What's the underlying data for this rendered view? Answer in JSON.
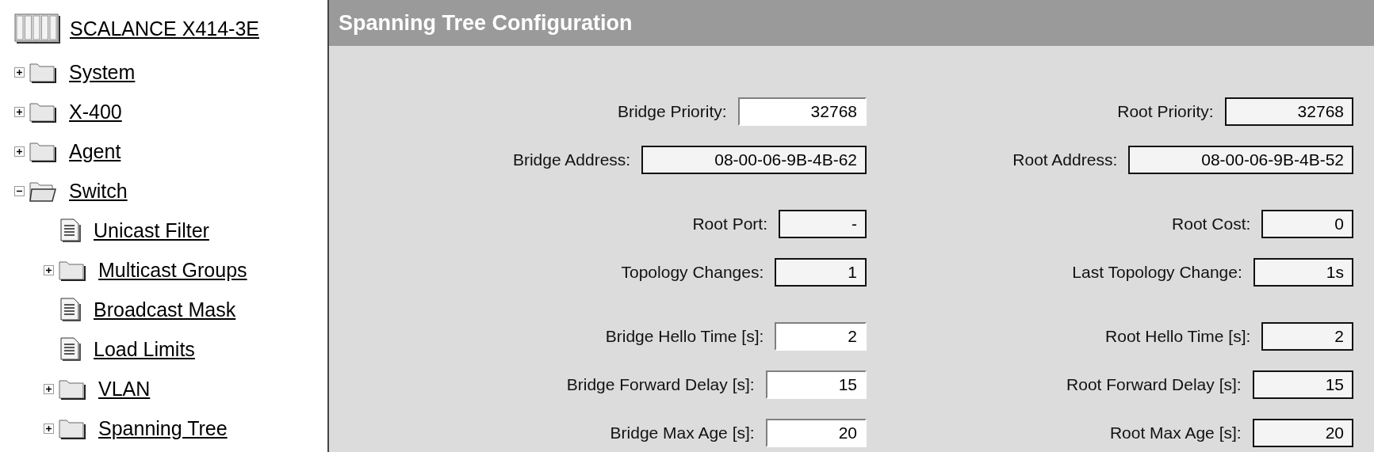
{
  "device": {
    "name": "SCALANCE X414-3E"
  },
  "tree": [
    {
      "label": "System",
      "kind": "folder",
      "expanded": false
    },
    {
      "label": "X-400",
      "kind": "folder",
      "expanded": false
    },
    {
      "label": "Agent",
      "kind": "folder",
      "expanded": false
    },
    {
      "label": "Switch",
      "kind": "folder",
      "expanded": true,
      "children": [
        {
          "label": "Unicast Filter",
          "kind": "document"
        },
        {
          "label": "Multicast Groups",
          "kind": "folder",
          "expanded": false
        },
        {
          "label": "Broadcast Mask",
          "kind": "document"
        },
        {
          "label": "Load Limits",
          "kind": "document"
        },
        {
          "label": "VLAN",
          "kind": "folder",
          "expanded": false
        },
        {
          "label": "Spanning Tree",
          "kind": "folder",
          "expanded": false
        }
      ]
    }
  ],
  "panel": {
    "title": "Spanning Tree Configuration",
    "groups": [
      [
        {
          "left": {
            "label": "Bridge Priority:",
            "value": "32768",
            "kind": "editable"
          },
          "right": {
            "label": "Root Priority:",
            "value": "32768",
            "kind": "readonly"
          }
        },
        {
          "left": {
            "label": "Bridge Address:",
            "value": "08-00-06-9B-4B-62",
            "kind": "readonly"
          },
          "right": {
            "label": "Root Address:",
            "value": "08-00-06-9B-4B-52",
            "kind": "readonly"
          }
        }
      ],
      [
        {
          "left": {
            "label": "Root Port:",
            "value": "-",
            "kind": "readonly"
          },
          "right": {
            "label": "Root Cost:",
            "value": "0",
            "kind": "readonly"
          }
        },
        {
          "left": {
            "label": "Topology Changes:",
            "value": "1",
            "kind": "readonly"
          },
          "right": {
            "label": "Last Topology Change:",
            "value": "1s",
            "kind": "readonly"
          }
        }
      ],
      [
        {
          "left": {
            "label": "Bridge Hello Time [s]:",
            "value": "2",
            "kind": "editable"
          },
          "right": {
            "label": "Root Hello Time [s]:",
            "value": "2",
            "kind": "readonly"
          }
        },
        {
          "left": {
            "label": "Bridge Forward Delay [s]:",
            "value": "15",
            "kind": "editable"
          },
          "right": {
            "label": "Root Forward Delay [s]:",
            "value": "15",
            "kind": "readonly"
          }
        },
        {
          "left": {
            "label": "Bridge Max Age [s]:",
            "value": "20",
            "kind": "editable"
          },
          "right": {
            "label": "Root Max Age [s]:",
            "value": "20",
            "kind": "readonly"
          }
        }
      ]
    ]
  }
}
